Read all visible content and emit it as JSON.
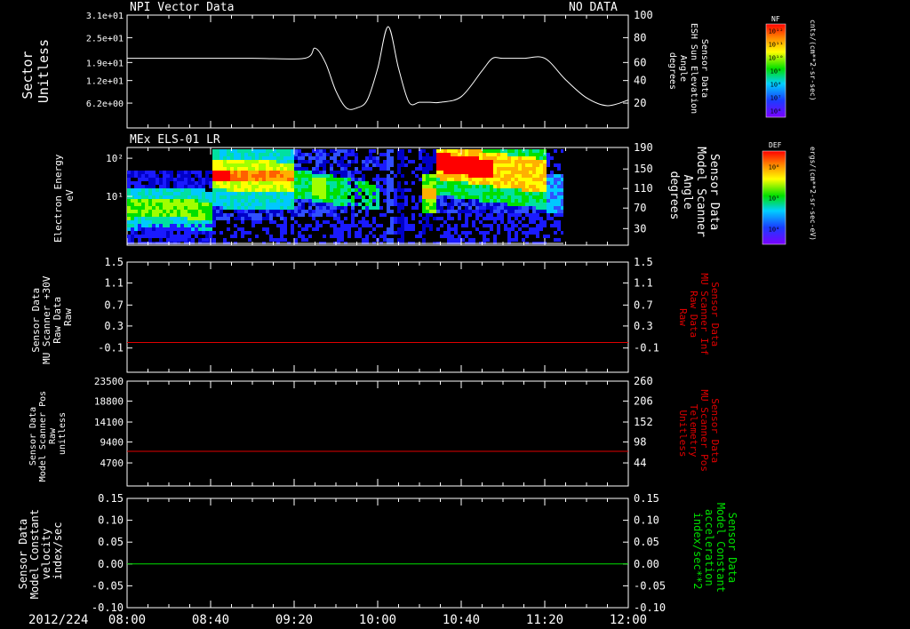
{
  "header": {
    "date": "2012/224"
  },
  "time_axis": {
    "labels": [
      "08:00",
      "08:40",
      "09:20",
      "10:00",
      "10:40",
      "11:20",
      "12:00"
    ]
  },
  "colors": {
    "fg": "#ffffff",
    "bg": "#000000",
    "red": "#e00000",
    "green": "#00e000"
  },
  "chart_data": [
    {
      "type": "line",
      "title": "NPI Vector Data",
      "title_right": "NO DATA",
      "left_axis": {
        "label_lines": [
          "Sector",
          "Unitless"
        ],
        "ticks": [
          "3.1e+01",
          "2.5e+01",
          "1.9e+01",
          "1.2e+01",
          "6.2e+00"
        ]
      },
      "right_axis": {
        "label_lines": [
          "Sensor Data",
          "ESH Sun Elevation",
          "Angle",
          "degrees"
        ],
        "ticks": [
          "100",
          "80",
          "60",
          "40",
          "20"
        ],
        "ylim": [
          0,
          100
        ]
      },
      "series": [
        {
          "name": "ESH Sun Elevation Angle",
          "x": [
            "08:00",
            "08:30",
            "09:00",
            "09:25",
            "09:30",
            "09:35",
            "09:40",
            "09:45",
            "09:50",
            "09:55",
            "10:00",
            "10:05",
            "10:10",
            "10:15",
            "10:20",
            "10:25",
            "10:30",
            "10:40",
            "10:50",
            "10:55",
            "11:00",
            "11:10",
            "11:20",
            "11:30",
            "11:40",
            "11:50",
            "12:00"
          ],
          "values": [
            57,
            57,
            57,
            57,
            66,
            53,
            28,
            13,
            13,
            20,
            48,
            85,
            48,
            18,
            18,
            18,
            18,
            23,
            46,
            57,
            57,
            57,
            57,
            38,
            22,
            15,
            20
          ]
        }
      ]
    },
    {
      "type": "heatmap",
      "title": "MEx ELS-01 LR",
      "left_axis": {
        "label_lines": [
          "Electron Energy",
          "eV"
        ],
        "ticks": [
          "10²",
          "10¹"
        ],
        "scale": "log"
      },
      "right_axis": {
        "label_lines": [
          "Sensor Data",
          "Model Scanner",
          "Angle",
          "degrees"
        ],
        "ticks": [
          "190",
          "150",
          "110",
          "70",
          "30"
        ]
      },
      "colorbar": {
        "label": "DEF",
        "unit": "ergs/(cm**2-sr-sec-eV)",
        "ticks": [
          "10⁶",
          "10⁵",
          "10⁴"
        ]
      },
      "data_extent": {
        "start": "08:00",
        "end": "11:25"
      },
      "bands": [
        {
          "from": "08:00",
          "to": "08:40",
          "log_e_lo": 0.85,
          "log_e_hi": 1.25,
          "level": "green"
        },
        {
          "from": "08:40",
          "to": "09:20",
          "log_e_lo": 1.4,
          "log_e_hi": 2.0,
          "level": "yellow-red"
        },
        {
          "from": "10:25",
          "to": "10:50",
          "log_e_lo": 1.6,
          "log_e_hi": 2.2,
          "level": "red"
        }
      ]
    },
    {
      "type": "line",
      "left_axis": {
        "label_lines": [
          "Sensor Data",
          "MU Scanner +30V",
          "Raw Data",
          "Raw"
        ],
        "ticks": [
          "1.5",
          "1.1",
          "0.7",
          "0.3",
          "-0.1"
        ]
      },
      "right_axis": {
        "label_lines": [
          "Sensor Data",
          "MU Scanner Inf",
          "Raw Data",
          "Raw"
        ],
        "ticks": [
          "1.5",
          "1.1",
          "0.7",
          "0.3",
          "-0.1"
        ]
      },
      "series": [
        {
          "value": 0.0,
          "color": "red"
        }
      ]
    },
    {
      "type": "line",
      "left_axis": {
        "label_lines": [
          "Sensor Data",
          "Model Scanner Pos",
          "Raw",
          "unitless"
        ],
        "ticks": [
          "23500",
          "18800",
          "14100",
          "9400",
          "4700"
        ]
      },
      "right_axis": {
        "label_lines": [
          "Sensor Data",
          "MU Scanner Pos",
          "Telemetry",
          "Unitless"
        ],
        "ticks": [
          "260",
          "206",
          "152",
          "98",
          "44"
        ]
      },
      "series": [
        {
          "value": 85,
          "color": "red"
        }
      ]
    },
    {
      "type": "line",
      "left_axis": {
        "label_lines": [
          "Sensor Data",
          "Model Constant",
          "velocity",
          "index/sec"
        ],
        "ticks": [
          "0.15",
          "0.10",
          "0.05",
          "0.00",
          "-0.05",
          "-0.10"
        ]
      },
      "right_axis": {
        "label_lines": [
          "Sensor Data",
          "Model Constant",
          "acceleration",
          "index/sec**2"
        ],
        "ticks": [
          "0.15",
          "0.10",
          "0.05",
          "0.00",
          "-0.05",
          "-0.10"
        ]
      },
      "series": [
        {
          "value": 0.0,
          "color": "green"
        }
      ]
    }
  ],
  "colorbars": [
    {
      "label": "NF",
      "unit": "cnts/(cm**2-sr-sec)",
      "ticks": [
        "10¹²",
        "10¹¹",
        "10¹⁰",
        "10⁹",
        "10⁸",
        "10⁷",
        "10⁶"
      ]
    },
    {
      "label": "DEF",
      "unit": "ergs/(cm**2-sr-sec-eV)",
      "ticks": [
        "10⁶",
        "10⁵",
        "10⁴"
      ]
    }
  ]
}
